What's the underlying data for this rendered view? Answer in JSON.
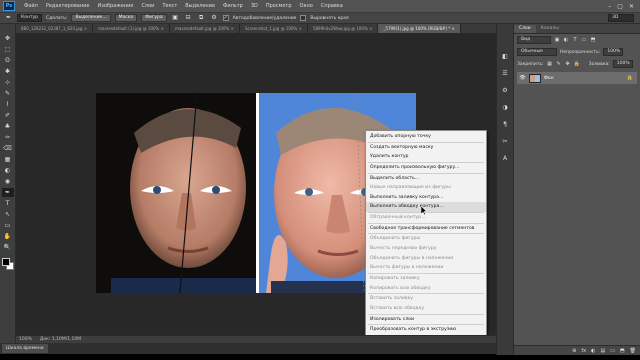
{
  "app": {
    "logo": "Ps"
  },
  "menubar": {
    "items": [
      "Файл",
      "Редактирование",
      "Изображение",
      "Слои",
      "Текст",
      "Выделение",
      "Фильтр",
      "3D",
      "Просмотр",
      "Окно",
      "Справка"
    ],
    "controls": [
      "–",
      "▢",
      "✕"
    ]
  },
  "options": {
    "mode": "Контур",
    "make_label": "Сделать:",
    "selection_btn": "Выделение...",
    "mask_btn": "Маска",
    "shape_btn": "Фигура",
    "auto_add_label": "Автодобавление/удаление",
    "auto_add_checked": "✓",
    "align_edges_label": "Выровнять края",
    "workspace": "3D"
  },
  "tabs": [
    {
      "label": "8B0_126232_02387_1_620.jpg ×",
      "active": false
    },
    {
      "label": "maxresdefault (1).jpg @ 100% ×",
      "active": false
    },
    {
      "label": "maxresdefault.jpg @ 100% ×",
      "active": false
    },
    {
      "label": "Screenshot_1.jpg @ 100% ×",
      "active": false
    },
    {
      "label": "5899h4v2Wxw.jpg @ 100% ×",
      "active": false
    },
    {
      "label": "_5799(1).jpg @ 100% (RGB/8#) * ×",
      "active": true
    }
  ],
  "tools": [
    "✥",
    "⬚",
    "ʘ",
    "✱",
    "⊹",
    "✎",
    "⌇",
    "✐",
    "♣",
    "✑",
    "⌫",
    "▦",
    "◐",
    "◉",
    "✒",
    "T",
    "↖",
    "▭",
    "✋",
    "🔍"
  ],
  "status": {
    "zoom": "100%",
    "doc": "Док: 1,10M/1,10M"
  },
  "mini_panel": {
    "label": "Шкала времени"
  },
  "side_icons": [
    "◧",
    "☰",
    "⚙",
    "◑",
    "¶",
    "✂",
    "A"
  ],
  "panel": {
    "tabs": [
      "Слои",
      "Каналы"
    ],
    "kind": "Вид",
    "blend": "Обычные",
    "opacity_label": "Непрозрачность:",
    "opacity": "100%",
    "lock_label": "Закрепить:",
    "fill_label": "Заливка:",
    "fill": "100%",
    "layer_name": "Фон",
    "footer_icons": [
      "⊕",
      "fx",
      "◐",
      "▤",
      "▭",
      "⬒",
      "🗑"
    ]
  },
  "context_menu": {
    "items": [
      {
        "label": "Добавить опорную точку",
        "disabled": false,
        "hl": false
      },
      {
        "sep": true
      },
      {
        "label": "Создать векторную маску",
        "disabled": false,
        "hl": false
      },
      {
        "label": "Удалить контур",
        "disabled": false,
        "hl": false
      },
      {
        "sep": true
      },
      {
        "label": "Определить произвольную фигуру...",
        "disabled": false,
        "hl": false
      },
      {
        "sep": true
      },
      {
        "label": "Выделить область...",
        "disabled": false,
        "hl": false
      },
      {
        "label": "Новые направляющие из фигуры",
        "disabled": true,
        "hl": false
      },
      {
        "label": "Выполнить заливку контура...",
        "disabled": false,
        "hl": false
      },
      {
        "label": "Выполнить обводку контура...",
        "disabled": false,
        "hl": true
      },
      {
        "sep": true
      },
      {
        "label": "Обтравочный контур...",
        "disabled": true,
        "hl": false
      },
      {
        "sep": true
      },
      {
        "label": "Свободное трансформирование сегментов",
        "disabled": false,
        "hl": false
      },
      {
        "sep": true
      },
      {
        "label": "Объединить фигуры",
        "disabled": true,
        "hl": false
      },
      {
        "label": "Вычесть переднюю фигуру",
        "disabled": true,
        "hl": false
      },
      {
        "label": "Объединить фигуры в наложении",
        "disabled": true,
        "hl": false
      },
      {
        "label": "Вычесть фигуры в наложении",
        "disabled": true,
        "hl": false
      },
      {
        "sep": true
      },
      {
        "label": "Копировать заливку",
        "disabled": true,
        "hl": false
      },
      {
        "label": "Копировать всю обводку",
        "disabled": true,
        "hl": false
      },
      {
        "sep": true
      },
      {
        "label": "Вставить заливку",
        "disabled": true,
        "hl": false
      },
      {
        "label": "Вставить всю обводку",
        "disabled": true,
        "hl": false
      },
      {
        "sep": true
      },
      {
        "label": "Изолировать слои",
        "disabled": false,
        "hl": false
      },
      {
        "sep": true
      },
      {
        "label": "Преобразовать контур в экструзию",
        "disabled": false,
        "hl": false
      },
      {
        "label": "Создать ограничение из контура",
        "disabled": true,
        "hl": false
      }
    ]
  }
}
